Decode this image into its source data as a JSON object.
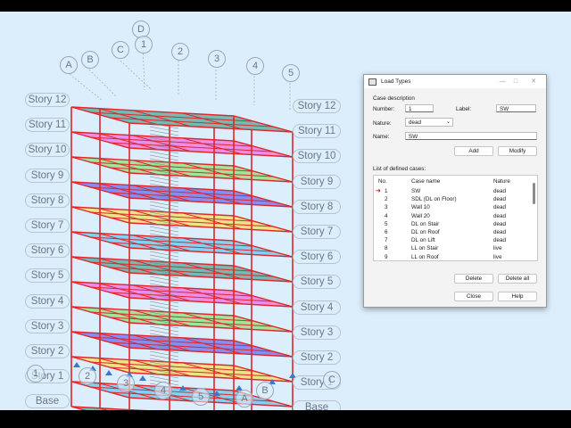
{
  "viewport": {
    "stories_left": [
      "Story 12",
      "Story 11",
      "Story 10",
      "Story 9",
      "Story 8",
      "Story 7",
      "Story 6",
      "Story 5",
      "Story 4",
      "Story 3",
      "Story 2",
      "Story 1",
      "Base"
    ],
    "stories_right": [
      "Story 12",
      "Story 11",
      "Story 10",
      "Story 9",
      "Story 8",
      "Story 7",
      "Story 6",
      "Story 5",
      "Story 4",
      "Story 3",
      "Story 2",
      "Story 1",
      "Base"
    ],
    "grid_top": [
      "A",
      "B",
      "C",
      "D",
      "1",
      "2",
      "3",
      "4",
      "5"
    ],
    "grid_bottom": [
      "1",
      "2",
      "3",
      "4",
      "5",
      "A",
      "B",
      "C"
    ]
  },
  "dialog": {
    "title": "Load Types",
    "window_buttons": [
      "—",
      "□",
      "✕"
    ],
    "case_description_title": "Case description",
    "number_label": "Number:",
    "number_value": "1",
    "label_label": "Label:",
    "label_value": "SW",
    "nature_label": "Nature:",
    "nature_value": "dead",
    "name_label": "Name:",
    "name_value": "SW",
    "add_button": "Add",
    "modify_button": "Modify",
    "list_title": "List of defined cases:",
    "columns": [
      "No.",
      "Case name",
      "Nature"
    ],
    "rows": [
      {
        "no": "1",
        "name": "SW",
        "nature": "dead",
        "selected": true
      },
      {
        "no": "2",
        "name": "SDL (DL on Floor)",
        "nature": "dead"
      },
      {
        "no": "3",
        "name": "Wall 10",
        "nature": "dead"
      },
      {
        "no": "4",
        "name": "Wall 20",
        "nature": "dead"
      },
      {
        "no": "5",
        "name": "DL on Stair",
        "nature": "dead"
      },
      {
        "no": "6",
        "name": "DL on Roof",
        "nature": "dead"
      },
      {
        "no": "7",
        "name": "DL on Lift",
        "nature": "dead"
      },
      {
        "no": "8",
        "name": "LL on Stair",
        "nature": "live"
      },
      {
        "no": "9",
        "name": "LL on Roof",
        "nature": "live"
      }
    ],
    "delete_button": "Delete",
    "delete_all_button": "Delete all",
    "close_button": "Close",
    "help_button": "Help"
  },
  "colors": {
    "frame": "#e0262a",
    "slab_colors": [
      "#54a898",
      "#f06ee0",
      "#8ee07a",
      "#6a6cf0",
      "#f0e060",
      "#66c8f0"
    ],
    "arrow": "#c21414"
  }
}
